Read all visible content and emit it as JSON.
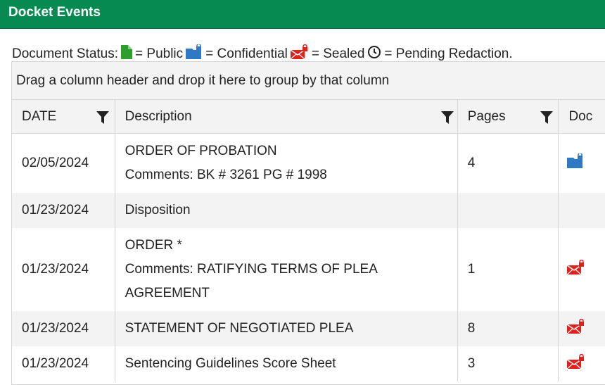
{
  "header": {
    "title": "Docket Events"
  },
  "legend": {
    "prefix": "Document Status:",
    "public": "= Public",
    "confidential": "= Confidential",
    "sealed": "= Sealed",
    "pending": "= Pending Redaction."
  },
  "grid": {
    "group_hint": "Drag a column header and drop it here to group by that column",
    "columns": [
      "DATE",
      "Description",
      "Pages",
      "Doc"
    ],
    "rows": [
      {
        "date": "02/05/2024",
        "lines": [
          "ORDER OF PROBATION",
          "Comments: BK # 3261 PG # 1998"
        ],
        "pages": "4",
        "doc": "confidential"
      },
      {
        "date": "01/23/2024",
        "lines": [
          "Disposition"
        ],
        "pages": "",
        "doc": ""
      },
      {
        "date": "01/23/2024",
        "lines": [
          "ORDER *",
          "Comments: RATIFYING TERMS OF PLEA",
          "AGREEMENT"
        ],
        "pages": "1",
        "doc": "sealed"
      },
      {
        "date": "01/23/2024",
        "lines": [
          "STATEMENT OF NEGOTIATED PLEA"
        ],
        "pages": "8",
        "doc": "sealed"
      },
      {
        "date": "01/23/2024",
        "lines": [
          "Sentencing Guidelines Score Sheet"
        ],
        "pages": "3",
        "doc": "sealed"
      }
    ]
  },
  "colors": {
    "header_bg": "#068a52",
    "public": "#2e9e2e",
    "confidential": "#2f78c4",
    "sealed": "#e0201c"
  }
}
